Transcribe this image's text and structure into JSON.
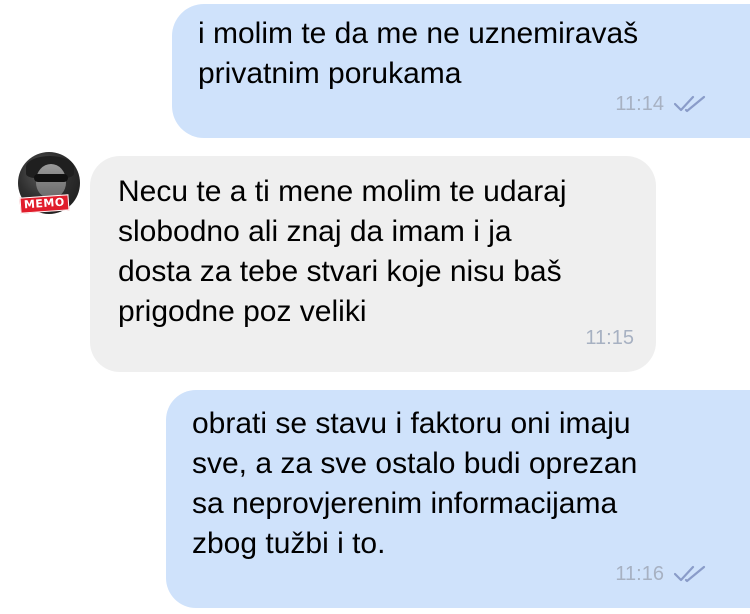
{
  "messages": [
    {
      "text": "i molim te da me ne uznemiravaš\nprivatnim porukama",
      "time": "11:14",
      "direction": "outgoing",
      "status_icon": "double-check-icon"
    },
    {
      "text": "Necu te a ti mene molim te udaraj\nslobodno ali znaj da imam i ja\ndosta za tebe stvari koje nisu baš\nprigodne poz veliki",
      "time": "11:15",
      "direction": "incoming"
    },
    {
      "text": "obrati se stavu i faktoru oni imaju\nsve, a za sve ostalo budi oprezan\nsa neprovjerenim informacijama\nzbog tužbi i to.",
      "time": "11:16",
      "direction": "outgoing",
      "status_icon": "double-check-icon"
    }
  ],
  "avatar": {
    "badge": "MEMO"
  },
  "colors": {
    "outgoing_bubble": "#cfe2fb",
    "incoming_bubble": "#efefef",
    "check_color": "#8a9cc9",
    "timestamp": "#a7b1c2"
  }
}
